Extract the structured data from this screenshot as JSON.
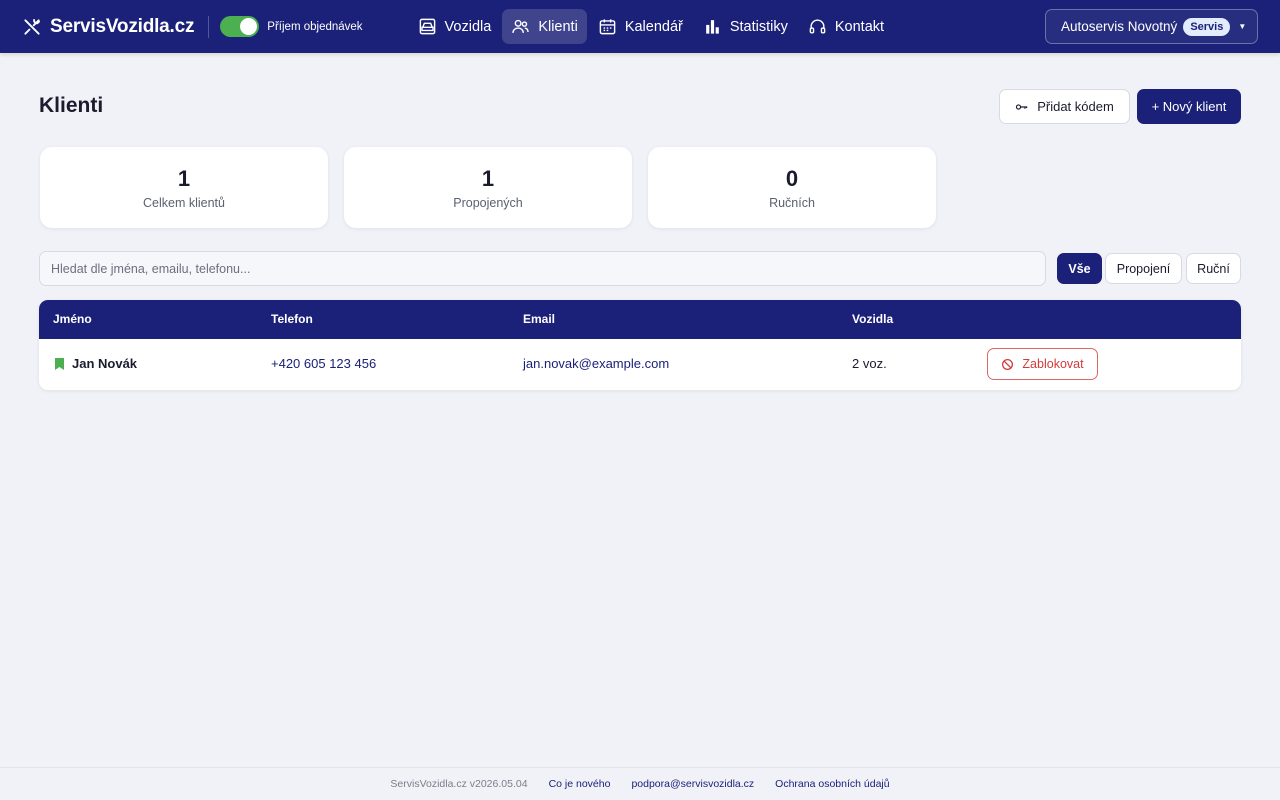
{
  "brand": {
    "name": "ServisVozidla.cz"
  },
  "order_toggle": {
    "label": "Příjem objednávek",
    "on": true
  },
  "nav": [
    {
      "label": "Vozidla",
      "icon": "car-icon",
      "active": false
    },
    {
      "label": "Klienti",
      "icon": "users-icon",
      "active": true
    },
    {
      "label": "Kalendář",
      "icon": "calendar-icon",
      "active": false
    },
    {
      "label": "Statistiky",
      "icon": "bar-chart-icon",
      "active": false
    },
    {
      "label": "Kontakt",
      "icon": "headset-icon",
      "active": false
    }
  ],
  "account": {
    "name": "Autoservis Novotný",
    "role_badge": "Servis"
  },
  "page": {
    "title": "Klienti",
    "add_by_code_label": "Přidat kódem",
    "new_client_label": "+ Nový klient"
  },
  "stats": [
    {
      "value": "1",
      "label": "Celkem klientů"
    },
    {
      "value": "1",
      "label": "Propojených"
    },
    {
      "value": "0",
      "label": "Ručních"
    }
  ],
  "search": {
    "placeholder": "Hledat dle jména, emailu, telefonu...",
    "value": ""
  },
  "filters": [
    {
      "label": "Vše",
      "active": true
    },
    {
      "label": "Propojení",
      "active": false
    },
    {
      "label": "Ruční",
      "active": false
    }
  ],
  "table": {
    "columns": [
      "Jméno",
      "Telefon",
      "Email",
      "Vozidla"
    ],
    "rows": [
      {
        "name": "Jan Novák",
        "phone": "+420 605 123 456",
        "email": "jan.novak@example.com",
        "vehicles": "2 voz.",
        "action": "Zablokovat"
      }
    ]
  },
  "footer": {
    "version": "ServisVozidla.cz v2026.05.04",
    "links": [
      "Co je nového",
      "podpora@servisvozidla.cz",
      "Ochrana osobních údajů"
    ]
  },
  "colors": {
    "primary": "#1b2178",
    "toggle_on": "#4caf50",
    "danger": "#d13b3b",
    "linked_marker": "#4caf50"
  }
}
